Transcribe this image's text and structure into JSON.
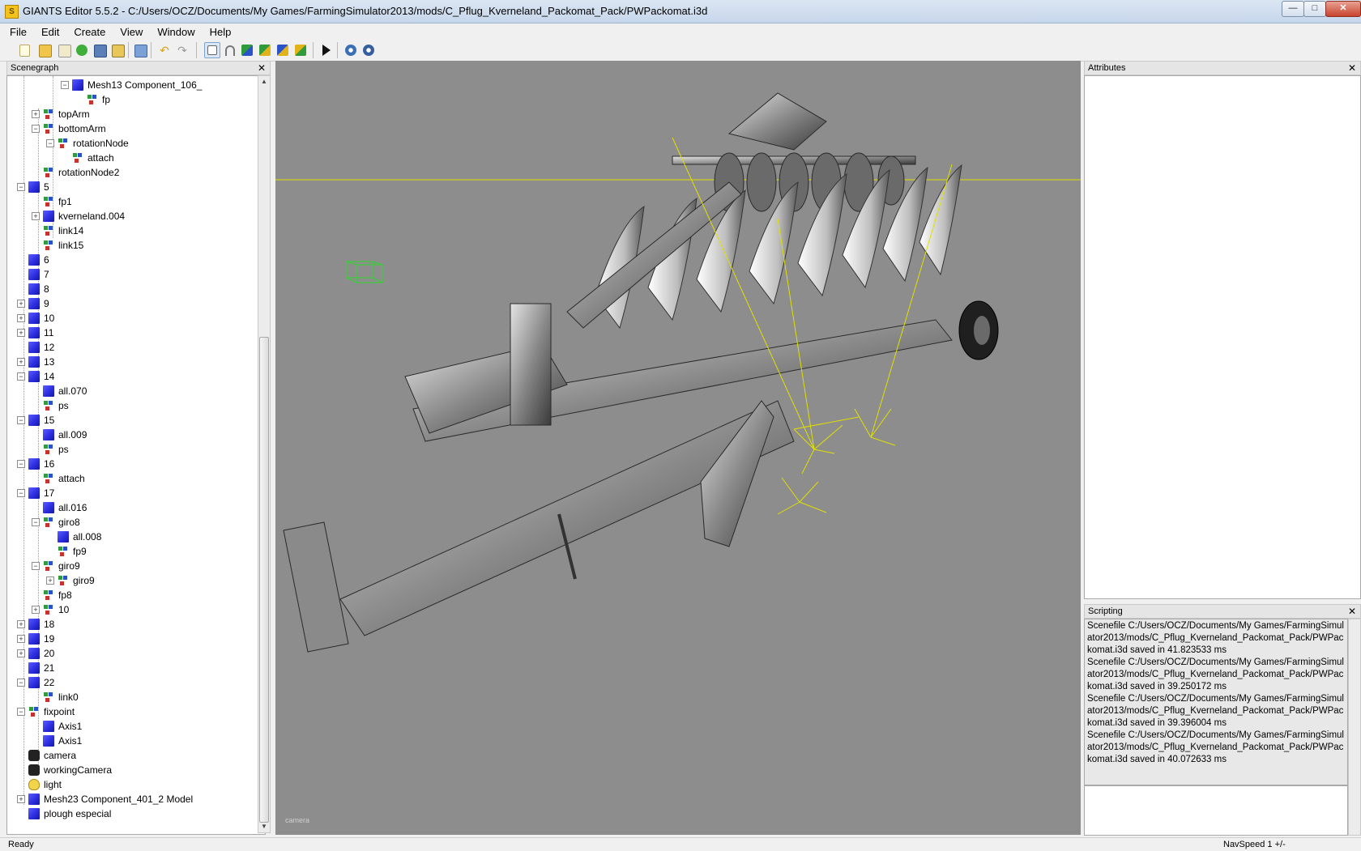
{
  "window": {
    "title": "GIANTS Editor 5.5.2 - C:/Users/OCZ/Documents/My Games/FarmingSimulator2013/mods/C_Pflug_Kverneland_Packomat_Pack/PWPackomat.i3d",
    "app_icon_letter": "S",
    "minimize": "—",
    "maximize": "□",
    "close": "✕"
  },
  "menu": {
    "file": "File",
    "edit": "Edit",
    "create": "Create",
    "view": "View",
    "window": "Window",
    "help": "Help"
  },
  "toolbar": {
    "icons": [
      "new-file-icon",
      "open-file-icon",
      "edit-icon",
      "refresh-icon",
      "save-icon",
      "export-icon",
      "import-icon",
      "undo-icon",
      "redo-icon",
      "select-tool-icon",
      "magnet-icon",
      "move-tool-icon",
      "rotate-tool-icon",
      "scale-tool-icon",
      "terrain-tool-icon",
      "play-icon",
      "settings-icon",
      "network-icon"
    ],
    "colors": {
      "accent": "#7ea3cf",
      "active_bg": "#d8e6f5"
    }
  },
  "scenegraph": {
    "title": "Scenegraph",
    "close": "✕",
    "rows": [
      {
        "label": "Mesh13 Component_106_",
        "icon": "cube",
        "depth": 3,
        "exp": "-"
      },
      {
        "label": "fp",
        "icon": "tg",
        "depth": 4,
        "exp": ""
      },
      {
        "label": "topArm",
        "icon": "tg",
        "depth": 1,
        "exp": "+"
      },
      {
        "label": "bottomArm",
        "icon": "tg",
        "depth": 1,
        "exp": "-"
      },
      {
        "label": "rotationNode",
        "icon": "tg",
        "depth": 2,
        "exp": "-"
      },
      {
        "label": "attach",
        "icon": "tg",
        "depth": 3,
        "exp": ""
      },
      {
        "label": "rotationNode2",
        "icon": "tg",
        "depth": 1,
        "exp": ""
      },
      {
        "label": "5",
        "icon": "cube",
        "depth": 0,
        "exp": "-"
      },
      {
        "label": "fp1",
        "icon": "tg",
        "depth": 1,
        "exp": ""
      },
      {
        "label": "kverneland.004",
        "icon": "cube",
        "depth": 1,
        "exp": "+"
      },
      {
        "label": "link14",
        "icon": "tg",
        "depth": 1,
        "exp": ""
      },
      {
        "label": "link15",
        "icon": "tg",
        "depth": 1,
        "exp": ""
      },
      {
        "label": "6",
        "icon": "cube",
        "depth": 0,
        "exp": ""
      },
      {
        "label": "7",
        "icon": "cube",
        "depth": 0,
        "exp": ""
      },
      {
        "label": "8",
        "icon": "cube",
        "depth": 0,
        "exp": ""
      },
      {
        "label": "9",
        "icon": "cube",
        "depth": 0,
        "exp": "+"
      },
      {
        "label": "10",
        "icon": "cube",
        "depth": 0,
        "exp": "+"
      },
      {
        "label": "11",
        "icon": "cube",
        "depth": 0,
        "exp": "+"
      },
      {
        "label": "12",
        "icon": "cube",
        "depth": 0,
        "exp": ""
      },
      {
        "label": "13",
        "icon": "cube",
        "depth": 0,
        "exp": "+"
      },
      {
        "label": "14",
        "icon": "cube",
        "depth": 0,
        "exp": "-"
      },
      {
        "label": "all.070",
        "icon": "cube",
        "depth": 1,
        "exp": ""
      },
      {
        "label": "ps",
        "icon": "tg",
        "depth": 1,
        "exp": ""
      },
      {
        "label": "15",
        "icon": "cube",
        "depth": 0,
        "exp": "-"
      },
      {
        "label": "all.009",
        "icon": "cube",
        "depth": 1,
        "exp": ""
      },
      {
        "label": "ps",
        "icon": "tg",
        "depth": 1,
        "exp": ""
      },
      {
        "label": "16",
        "icon": "cube",
        "depth": 0,
        "exp": "-"
      },
      {
        "label": "attach",
        "icon": "tg",
        "depth": 1,
        "exp": ""
      },
      {
        "label": "17",
        "icon": "cube",
        "depth": 0,
        "exp": "-"
      },
      {
        "label": "all.016",
        "icon": "cube",
        "depth": 1,
        "exp": ""
      },
      {
        "label": "giro8",
        "icon": "tg",
        "depth": 1,
        "exp": "-"
      },
      {
        "label": "all.008",
        "icon": "cube",
        "depth": 2,
        "exp": ""
      },
      {
        "label": "fp9",
        "icon": "tg",
        "depth": 2,
        "exp": ""
      },
      {
        "label": "giro9",
        "icon": "tg",
        "depth": 1,
        "exp": "-"
      },
      {
        "label": "giro9",
        "icon": "tg",
        "depth": 2,
        "exp": "+"
      },
      {
        "label": "fp8",
        "icon": "tg",
        "depth": 1,
        "exp": ""
      },
      {
        "label": "10",
        "icon": "tg",
        "depth": 1,
        "exp": "+"
      },
      {
        "label": "18",
        "icon": "cube",
        "depth": 0,
        "exp": "+"
      },
      {
        "label": "19",
        "icon": "cube",
        "depth": 0,
        "exp": "+"
      },
      {
        "label": "20",
        "icon": "cube",
        "depth": 0,
        "exp": "+"
      },
      {
        "label": "21",
        "icon": "cube",
        "depth": 0,
        "exp": ""
      },
      {
        "label": "22",
        "icon": "cube",
        "depth": 0,
        "exp": "-"
      },
      {
        "label": "link0",
        "icon": "tg",
        "depth": 1,
        "exp": ""
      },
      {
        "label": "fixpoint",
        "icon": "tg",
        "depth": 0,
        "exp": "-"
      },
      {
        "label": "Axis1",
        "icon": "cube",
        "depth": 1,
        "exp": ""
      },
      {
        "label": "Axis1",
        "icon": "cube",
        "depth": 1,
        "exp": ""
      },
      {
        "label": "camera",
        "icon": "cam",
        "depth": 0,
        "exp": ""
      },
      {
        "label": "workingCamera",
        "icon": "cam",
        "depth": 0,
        "exp": ""
      },
      {
        "label": "light",
        "icon": "bulb",
        "depth": 0,
        "exp": ""
      },
      {
        "label": "Mesh23 Component_401_2 Model",
        "icon": "cube",
        "depth": 0,
        "exp": "+"
      },
      {
        "label": "plough especial",
        "icon": "cube",
        "depth": 0,
        "exp": ""
      }
    ]
  },
  "viewport": {
    "camera_label": "camera",
    "background": "#8d8d8d"
  },
  "attributes": {
    "title": "Attributes",
    "close": "✕"
  },
  "scripting": {
    "title": "Scripting",
    "close": "✕",
    "lines": [
      "Scenefile C:/Users/OCZ/Documents/My Games/FarmingSimulator2013/mods/C_Pflug_Kverneland_Packomat_Pack/PWPackomat.i3d saved in 41.823533 ms",
      "Scenefile C:/Users/OCZ/Documents/My Games/FarmingSimulator2013/mods/C_Pflug_Kverneland_Packomat_Pack/PWPackomat.i3d saved in 39.250172 ms",
      "Scenefile C:/Users/OCZ/Documents/My Games/FarmingSimulator2013/mods/C_Pflug_Kverneland_Packomat_Pack/PWPackomat.i3d saved in 39.396004 ms",
      "Scenefile C:/Users/OCZ/Documents/My Games/FarmingSimulator2013/mods/C_Pflug_Kverneland_Packomat_Pack/PWPackomat.i3d saved in 40.072633 ms"
    ]
  },
  "status": {
    "left": "Ready",
    "right": "NavSpeed 1 +/-"
  }
}
